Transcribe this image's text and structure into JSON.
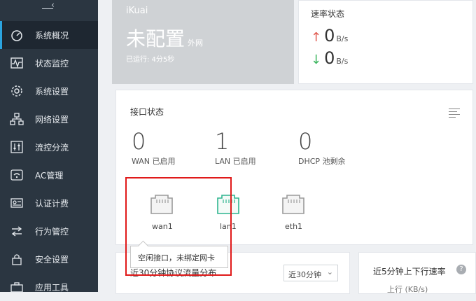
{
  "sidebar": {
    "items": [
      {
        "label": "系统概况",
        "icon": "dashboard-icon",
        "active": true
      },
      {
        "label": "状态监控",
        "icon": "monitor-wave-icon"
      },
      {
        "label": "系统设置",
        "icon": "gear-icon"
      },
      {
        "label": "网络设置",
        "icon": "network-icon"
      },
      {
        "label": "流控分流",
        "icon": "sliders-icon"
      },
      {
        "label": "AC管理",
        "icon": "wifi-ac-icon"
      },
      {
        "label": "认证计费",
        "icon": "id-card-icon"
      },
      {
        "label": "行为管控",
        "icon": "arrows-swap-icon"
      },
      {
        "label": "安全设置",
        "icon": "lock-icon"
      },
      {
        "label": "应用工具",
        "icon": "toolbox-icon"
      }
    ]
  },
  "brand": {
    "name": "iKuai",
    "status": "未配置",
    "status_sub": "外网",
    "uptime": "已运行: 4分5秒"
  },
  "rate": {
    "title": "速率状态",
    "up_value": "0",
    "up_unit": "B/s",
    "down_value": "0",
    "down_unit": "B/s"
  },
  "interface": {
    "title": "接口状态",
    "stats": [
      {
        "value": "0",
        "label": "WAN 已启用"
      },
      {
        "value": "1",
        "label": "LAN 已启用"
      },
      {
        "value": "0",
        "label": "DHCP 池剩余"
      }
    ],
    "ports": [
      {
        "name": "wan1",
        "color": "#9a9a9a"
      },
      {
        "name": "lan1",
        "color": "#2fb58f"
      },
      {
        "name": "eth1",
        "color": "#9a9a9a"
      }
    ],
    "tooltip": "空闲接口，未绑定网卡"
  },
  "bottom": {
    "protocol_title": "近30分钟协议流量分布",
    "range_select": "近30分钟",
    "rate_title": "近5分钟上下行速率",
    "rate_sub": "上行 (KB/s)",
    "help": "?"
  },
  "colors": {
    "sidebar_bg": "#2b3641",
    "accent": "#2ba4e0",
    "highlight": "#e01a1a"
  }
}
